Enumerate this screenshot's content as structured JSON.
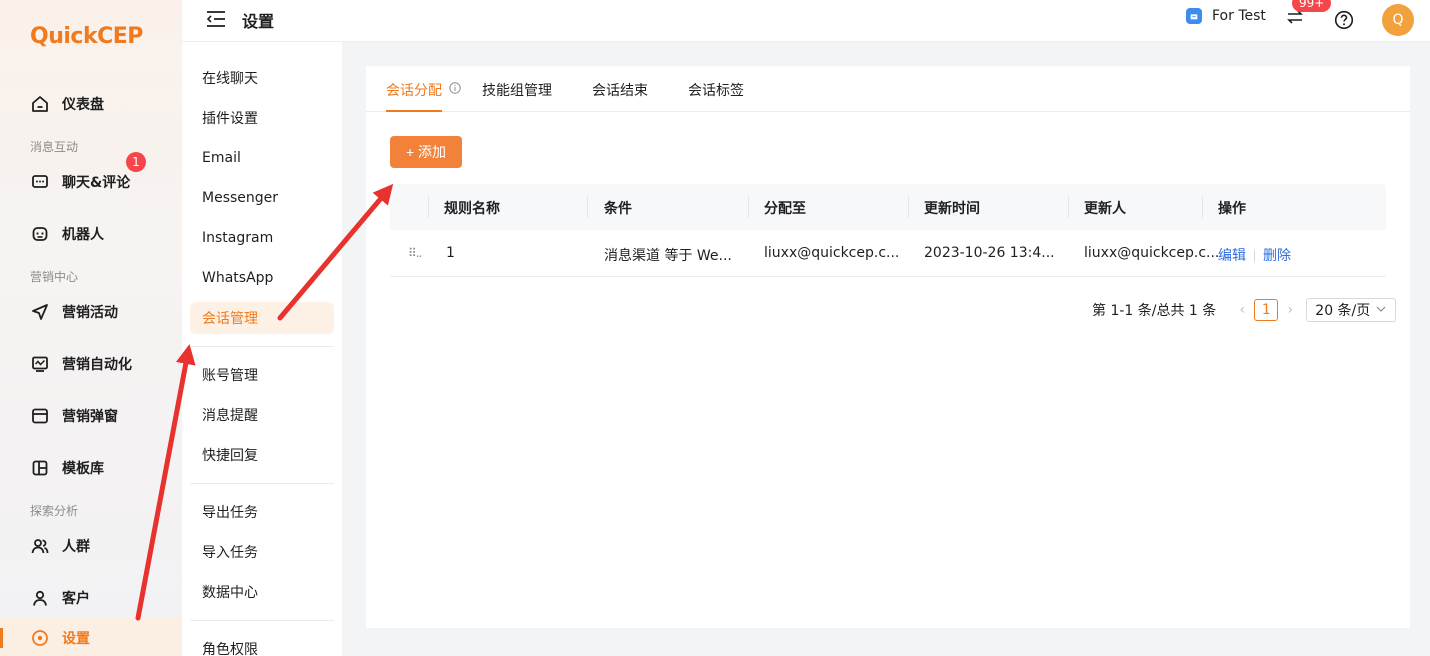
{
  "app": {
    "logo_text": "QuickCEP",
    "page_title": "设置"
  },
  "sidebar": {
    "items": [
      {
        "label": "仪表盘",
        "icon": "home-icon"
      },
      {
        "group": "消息互动"
      },
      {
        "label": "聊天&评论",
        "icon": "chat-icon",
        "badge": "1"
      },
      {
        "label": "机器人",
        "icon": "robot-icon"
      },
      {
        "group": "营销中心"
      },
      {
        "label": "营销活动",
        "icon": "send-icon"
      },
      {
        "label": "营销自动化",
        "icon": "automation-icon"
      },
      {
        "label": "营销弹窗",
        "icon": "popup-icon"
      },
      {
        "label": "模板库",
        "icon": "template-icon"
      },
      {
        "group": "探索分析"
      },
      {
        "label": "人群",
        "icon": "users-icon"
      },
      {
        "label": "客户",
        "icon": "user-icon"
      },
      {
        "label": "设置",
        "icon": "settings-icon",
        "active": true
      }
    ]
  },
  "header": {
    "env_label": "For Test",
    "notification_badge": "99+",
    "avatar_initial": "Q"
  },
  "submenu": {
    "items": [
      "在线聊天",
      "插件设置",
      "Email",
      "Messenger",
      "Instagram",
      "WhatsApp",
      "会话管理",
      "账号管理",
      "消息提醒",
      "快捷回复",
      "导出任务",
      "导入任务",
      "数据中心",
      "角色权限"
    ],
    "active": "会话管理"
  },
  "tabs": [
    "会话分配",
    "技能组管理",
    "会话结束",
    "会话标签"
  ],
  "active_tab": "会话分配",
  "add_button": "+ 添加",
  "table": {
    "columns": [
      "规则名称",
      "条件",
      "分配至",
      "更新时间",
      "更新人",
      "操作"
    ],
    "rows": [
      {
        "name": "1",
        "condition": "消息渠道 等于 We...",
        "assign_to": "liuxx@quickcep.c...",
        "updated_at": "2023-10-26 13:4...",
        "updated_by": "liuxx@quickcep.c...",
        "edit": "编辑",
        "delete": "删除"
      }
    ]
  },
  "pagination": {
    "total_text": "第 1-1 条/总共 1 条",
    "current_page": "1",
    "page_size": "20 条/页"
  },
  "colors": {
    "brand": "#f07a1e",
    "link": "#2f6ce0",
    "badge": "#f5464a",
    "annotation_arrow": "#e8322e"
  }
}
